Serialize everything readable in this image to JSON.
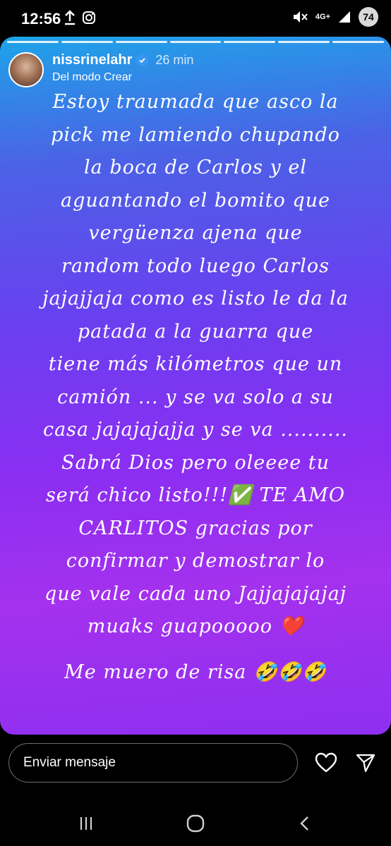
{
  "status_bar": {
    "time": "12:56",
    "battery": "74",
    "network": "4G+"
  },
  "story": {
    "username": "nissrinelahr",
    "time_ago": "26 min",
    "subtitle": "Del modo Crear",
    "body_text": "Estoy traumada que asco la\npick me lamiendo chupando\nla boca de Carlos y el\naguantando el bomito que\nvergüenza ajena que\nrandom todo luego Carlos\njajajjaja como es listo le da la\npatada a la guarra que\ntiene más kilómetros que un\ncamión ... y se va solo a su\ncasa jajajajajja y se va ..........\nSabrá Dios pero oleeee tu\nserá chico listo!!!✅ TE AMO\nCARLITOS gracias por\nconfirmar y demostrar lo\nque vale cada uno Jajjajajajaj\nmuaks guapooooo ❤️",
    "bottom_text": "Me muero de risa 🤣🤣🤣"
  },
  "message_bar": {
    "placeholder": "Enviar mensaje"
  },
  "icons": {
    "like": "heart-icon",
    "share": "send-icon",
    "verified": "verified-badge-icon"
  },
  "colors": {
    "gradient_top": "#1ea4e8",
    "gradient_bottom": "#a431ee"
  }
}
